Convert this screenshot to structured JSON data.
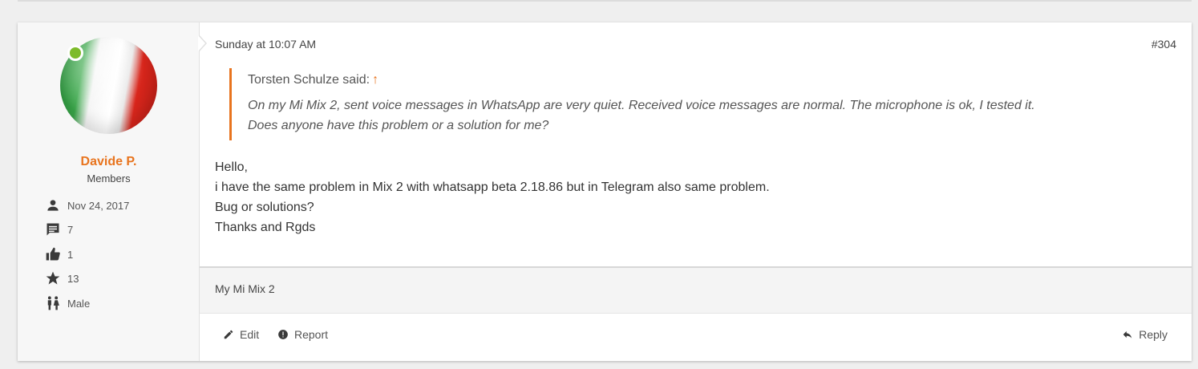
{
  "user": {
    "name": "Davide P.",
    "title": "Members",
    "stats": {
      "joined": "Nov 24, 2017",
      "messages": "7",
      "likes": "1",
      "points": "13",
      "gender": "Male"
    }
  },
  "post": {
    "time": "Sunday at 10:07 AM",
    "number": "#304",
    "quote": {
      "author": "Torsten Schulze said:",
      "lines": [
        "On my Mi Mix 2, sent voice messages in WhatsApp are very quiet. Received voice messages are normal. The microphone is ok, I tested it.",
        "Does anyone have this problem or a solution for me?"
      ]
    },
    "message": [
      "Hello,",
      "i have the same problem in Mix 2 with whatsapp beta 2.18.86 but in Telegram also same problem.",
      "Bug or solutions?",
      "Thanks and Rgds"
    ],
    "signature": "My Mi Mix 2"
  },
  "actions": {
    "edit": "Edit",
    "report": "Report",
    "reply": "Reply"
  },
  "colors": {
    "accent": "#e8741e",
    "online": "#7dbb2a"
  }
}
